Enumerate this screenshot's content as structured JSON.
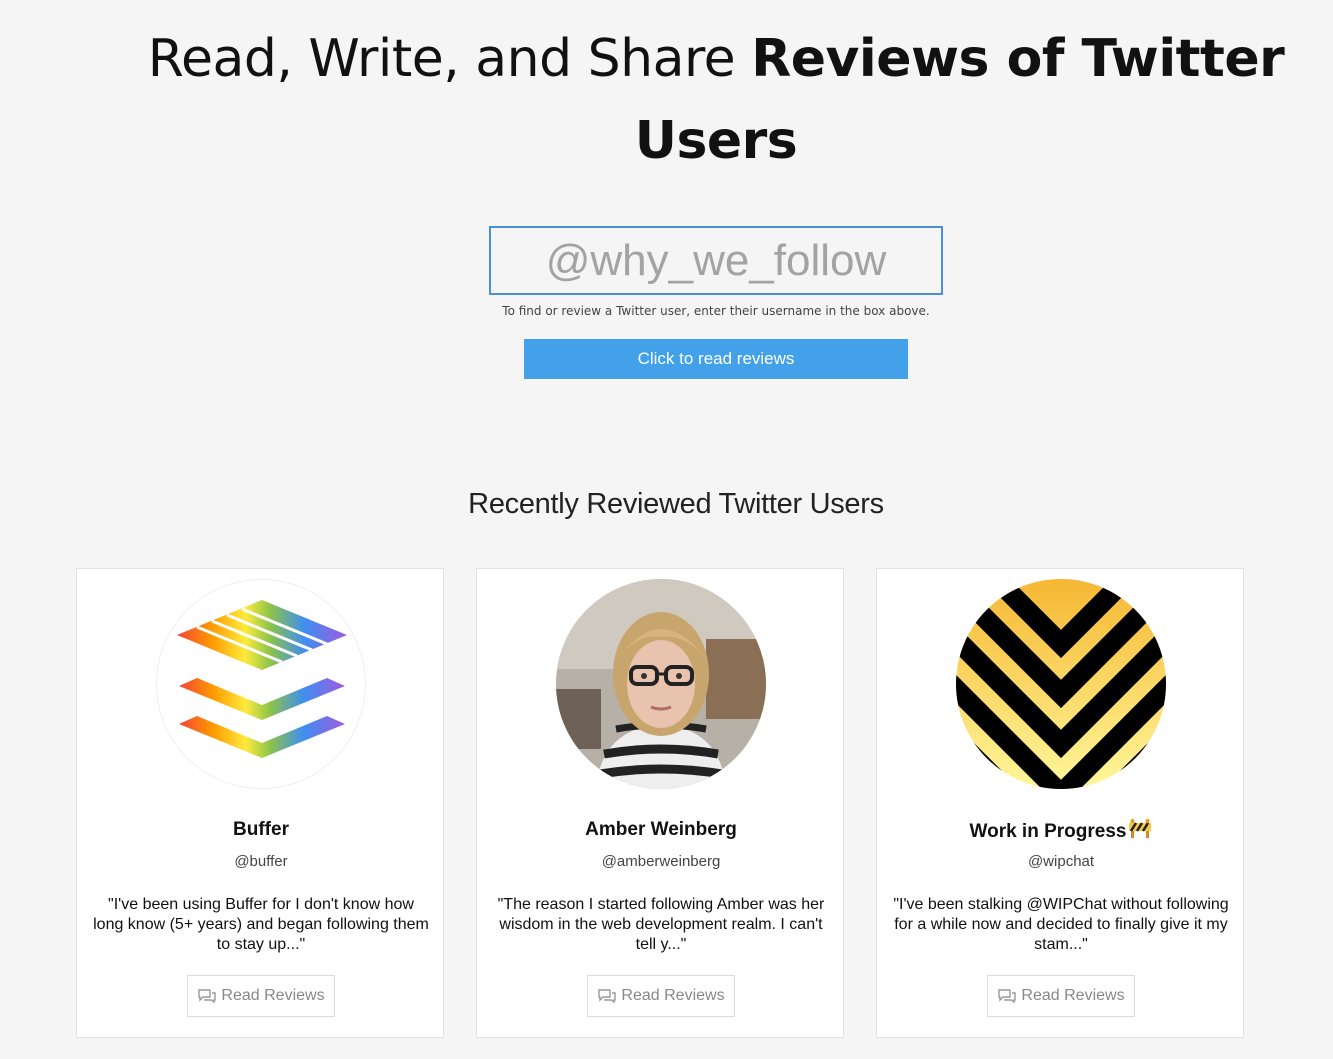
{
  "hero": {
    "title_light": "Read, Write, and Share ",
    "title_bold": "Reviews of Twitter Users"
  },
  "search": {
    "placeholder": "@why_we_follow",
    "hint": "To find or review a Twitter user, enter their username in the box above.",
    "button_label": "Click to read reviews"
  },
  "recent": {
    "title": "Recently Reviewed Twitter Users",
    "cards": [
      {
        "name": "Buffer",
        "handle": "@buffer",
        "quote": "\"I've been using Buffer for I don't know how long know (5+ years) and began following them to stay up...\"",
        "button_label": "Read Reviews",
        "avatar": "buffer-logo"
      },
      {
        "name": "Amber Weinberg",
        "handle": "@amberweinberg",
        "quote": "\"The reason I started following Amber was her wisdom in the web development realm. I can't tell y...\"",
        "button_label": "Read Reviews",
        "avatar": "user-photo"
      },
      {
        "name": "Work in Progress",
        "handle": "@wipchat",
        "quote": "\"I've been stalking @WIPChat without following for a while now and decided to finally give it my stam...\"",
        "button_label": "Read Reviews",
        "avatar": "wip-chevron-logo",
        "name_emoji": "construction-icon"
      }
    ]
  },
  "colors": {
    "background": "#f5f5f5",
    "accent": "#42a1e8",
    "input_border": "#4a90d9",
    "card_border": "#e2e2e2"
  }
}
